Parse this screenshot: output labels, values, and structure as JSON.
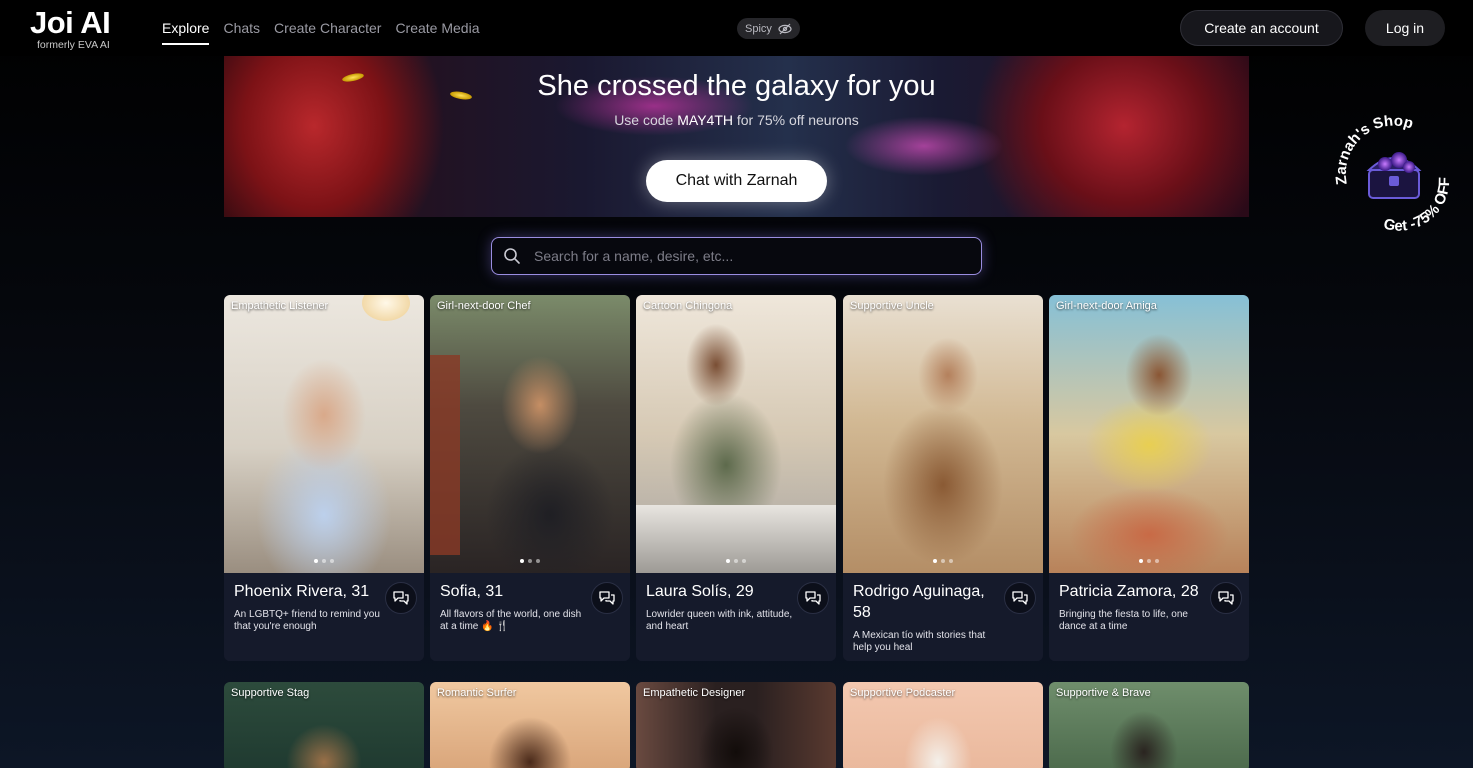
{
  "header": {
    "logo_title": "Joi AI",
    "logo_subtitle": "formerly EVA AI",
    "nav": [
      {
        "label": "Explore",
        "active": true
      },
      {
        "label": "Chats",
        "active": false
      },
      {
        "label": "Create Character",
        "active": false
      },
      {
        "label": "Create Media",
        "active": false
      }
    ],
    "spicy_label": "Spicy",
    "spicy_icon": "eye-off-icon",
    "create_account_label": "Create an account",
    "login_label": "Log in"
  },
  "banner": {
    "title": "She crossed the galaxy for you",
    "subtitle_pre": "Use code ",
    "promo_code": "MAY4TH",
    "subtitle_post": " for 75% off neurons",
    "button_label": "Chat with Zarnah"
  },
  "shop_badge": {
    "top_text": "Zarnah's Shop",
    "bottom_text": "Get -75% OFF",
    "icon": "treasure-chest-icon"
  },
  "search": {
    "placeholder": "Search for a name, desire, etc...",
    "value": ""
  },
  "cards": [
    {
      "tag": "Empathetic Listener",
      "name": "Phoenix Rivera, 31",
      "desc": "An LGBTQ+ friend to remind you that you're enough",
      "palette": [
        "#e9e4de",
        "#9fb8dd",
        "#5a4a3e"
      ]
    },
    {
      "tag": "Girl-next-door Chef",
      "name": "Sofia, 31",
      "desc": "All flavors of the world, one dish at a time 🔥 🍴",
      "palette": [
        "#6b5a48",
        "#2a2a2e",
        "#c08a5a"
      ]
    },
    {
      "tag": "Cartoon Chingona",
      "name": "Laura Solís, 29",
      "desc": "Lowrider queen with ink, attitude, and heart",
      "palette": [
        "#d8cbb8",
        "#5f6a4e",
        "#7a5034"
      ]
    },
    {
      "tag": "Supportive Uncle",
      "name": "Rodrigo Aguinaga, 58",
      "desc": "A Mexican tío with stories that help you heal",
      "palette": [
        "#d6c3a6",
        "#8a5a34",
        "#3d2a1c"
      ]
    },
    {
      "tag": "Girl-next-door Amiga",
      "name": "Patricia Zamora, 28",
      "desc": "Bringing the fiesta to life, one dance at a time",
      "palette": [
        "#7fb6c8",
        "#e6c44a",
        "#b85a3a"
      ]
    }
  ],
  "cards_row2": [
    {
      "tag": "Supportive Stag",
      "palette": [
        "#2a4a3a",
        "#6a5036"
      ]
    },
    {
      "tag": "Romantic Surfer",
      "palette": [
        "#e0b08a",
        "#5a3422"
      ]
    },
    {
      "tag": "Empathetic Designer",
      "palette": [
        "#3a2c2a",
        "#1a1412"
      ]
    },
    {
      "tag": "Supportive Podcaster",
      "palette": [
        "#f0cdb8",
        "#e8d8c8"
      ]
    },
    {
      "tag": "Supportive & Brave",
      "palette": [
        "#5a7a5a",
        "#2a2420"
      ]
    }
  ]
}
